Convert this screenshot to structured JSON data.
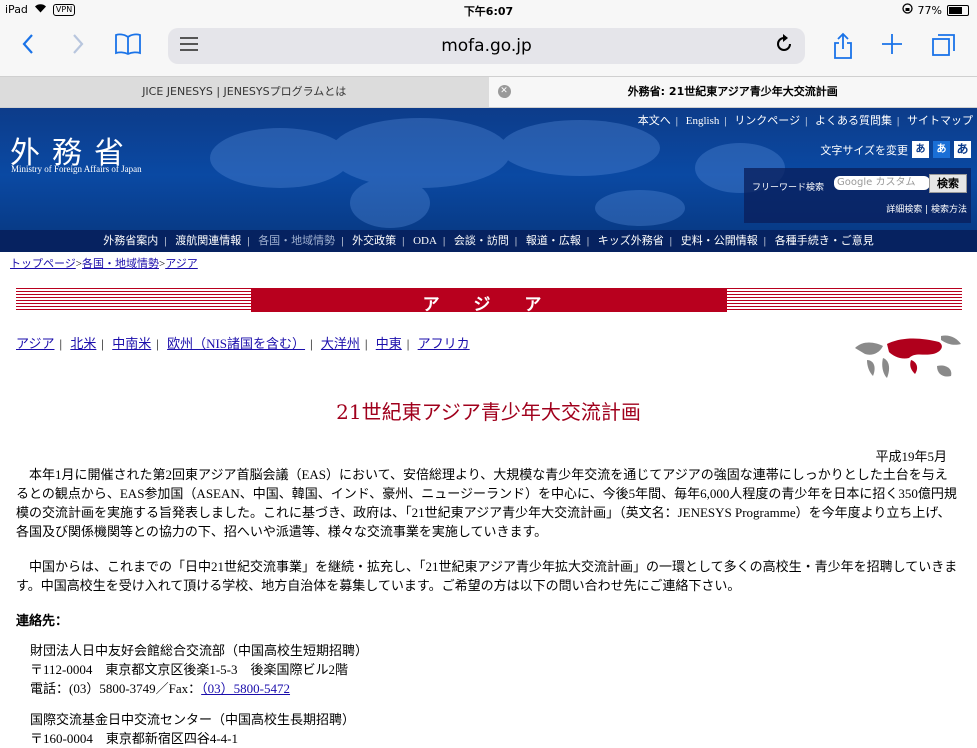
{
  "status_bar": {
    "device": "iPad",
    "vpn": "VPN",
    "time": "下午6:07",
    "battery_percent": "77%",
    "battery_level": 0.77
  },
  "toolbar": {
    "host": "mofa.go.jp",
    "icons": [
      "back-icon",
      "forward-icon",
      "bookmarks-icon",
      "reader-menu-icon",
      "reload-icon",
      "share-icon",
      "new-tab-icon",
      "tabs-icon"
    ]
  },
  "tabs": [
    {
      "title": "JICE JENESYS | JENESYSプログラムとは",
      "active": false
    },
    {
      "title": "外務省: 21世紀東アジア青少年大交流計画",
      "active": true
    }
  ],
  "site": {
    "logo_ja": "外務省",
    "logo_en": "Ministry of Foreign Affairs of Japan",
    "top_links": [
      "本文へ",
      "English",
      "リンクページ",
      "よくある質問集",
      "サイトマップ"
    ],
    "fontsize_label": "文字サイズを変更",
    "fontsize_buttons": [
      "あ",
      "あ",
      "あ"
    ],
    "search_label": "フリーワード検索",
    "search_placeholder": "Google カスタム",
    "search_button": "検索",
    "search_sub": "詳細検索 | 検索方法",
    "nav": [
      {
        "label": "外務省案内",
        "dim": false
      },
      {
        "label": "渡航関連情報",
        "dim": false
      },
      {
        "label": "各国・地域情勢",
        "dim": true
      },
      {
        "label": "外交政策",
        "dim": false
      },
      {
        "label": "ODA",
        "dim": false
      },
      {
        "label": "会談・訪問",
        "dim": false
      },
      {
        "label": "報道・広報",
        "dim": false
      },
      {
        "label": "キッズ外務省",
        "dim": false
      },
      {
        "label": "史料・公開情報",
        "dim": false
      },
      {
        "label": "各種手続き・ご意見",
        "dim": false
      }
    ]
  },
  "breadcrumb": [
    "トップページ",
    "各国・地域情勢",
    "アジア"
  ],
  "section_title": "ア ジ ア",
  "regions": [
    "アジア",
    "北米",
    "中南米",
    "欧州（NIS諸国を含む）",
    "大洋州",
    "中東",
    "アフリカ"
  ],
  "content": {
    "title": "21世紀東アジア青少年大交流計画",
    "date": "平成19年5月",
    "para1": "本年1月に開催された第2回東アジア首脳会議（EAS）において、安倍総理より、大規模な青少年交流を通じてアジアの強固な連帯にしっかりとした土台を与えるとの観点から、EAS参加国（ASEAN、中国、韓国、インド、豪州、ニュージーランド）を中心に、今後5年間、毎年6,000人程度の青少年を日本に招く350億円規模の交流計画を実施する旨発表しました。これに基づき、政府は、「21世紀東アジア青少年大交流計画」（英文名：JENESYS Programme）を今年度より立ち上げ、各国及び関係機関等との協力の下、招へいや派遣等、様々な交流事業を実施していきます。",
    "para2": "中国からは、これまでの「日中21世紀交流事業」を継続・拡充し、「21世紀東アジア青少年拡大交流計画」の一環として多くの高校生・青少年を招聘していきます。中国高校生を受け入れて頂ける学校、地方自治体を募集しています。ご希望の方は以下の問い合わせ先にご連絡下さい。",
    "contact_heading": "連絡先：",
    "contact1": {
      "org": "財団法人日中友好会館総合交流部（中国高校生短期招聘）",
      "address": "〒112-0004　東京都文京区後楽1-5-3　後楽国際ビル2階",
      "tel_prefix": "電話：(03）5800-3749／Fax：",
      "fax": "（03）5800-5472"
    },
    "contact2": {
      "org": "国際交流基金日中交流センター（中国高校生長期招聘）",
      "address": "〒160-0004　東京都新宿区四谷4-4-1"
    }
  }
}
